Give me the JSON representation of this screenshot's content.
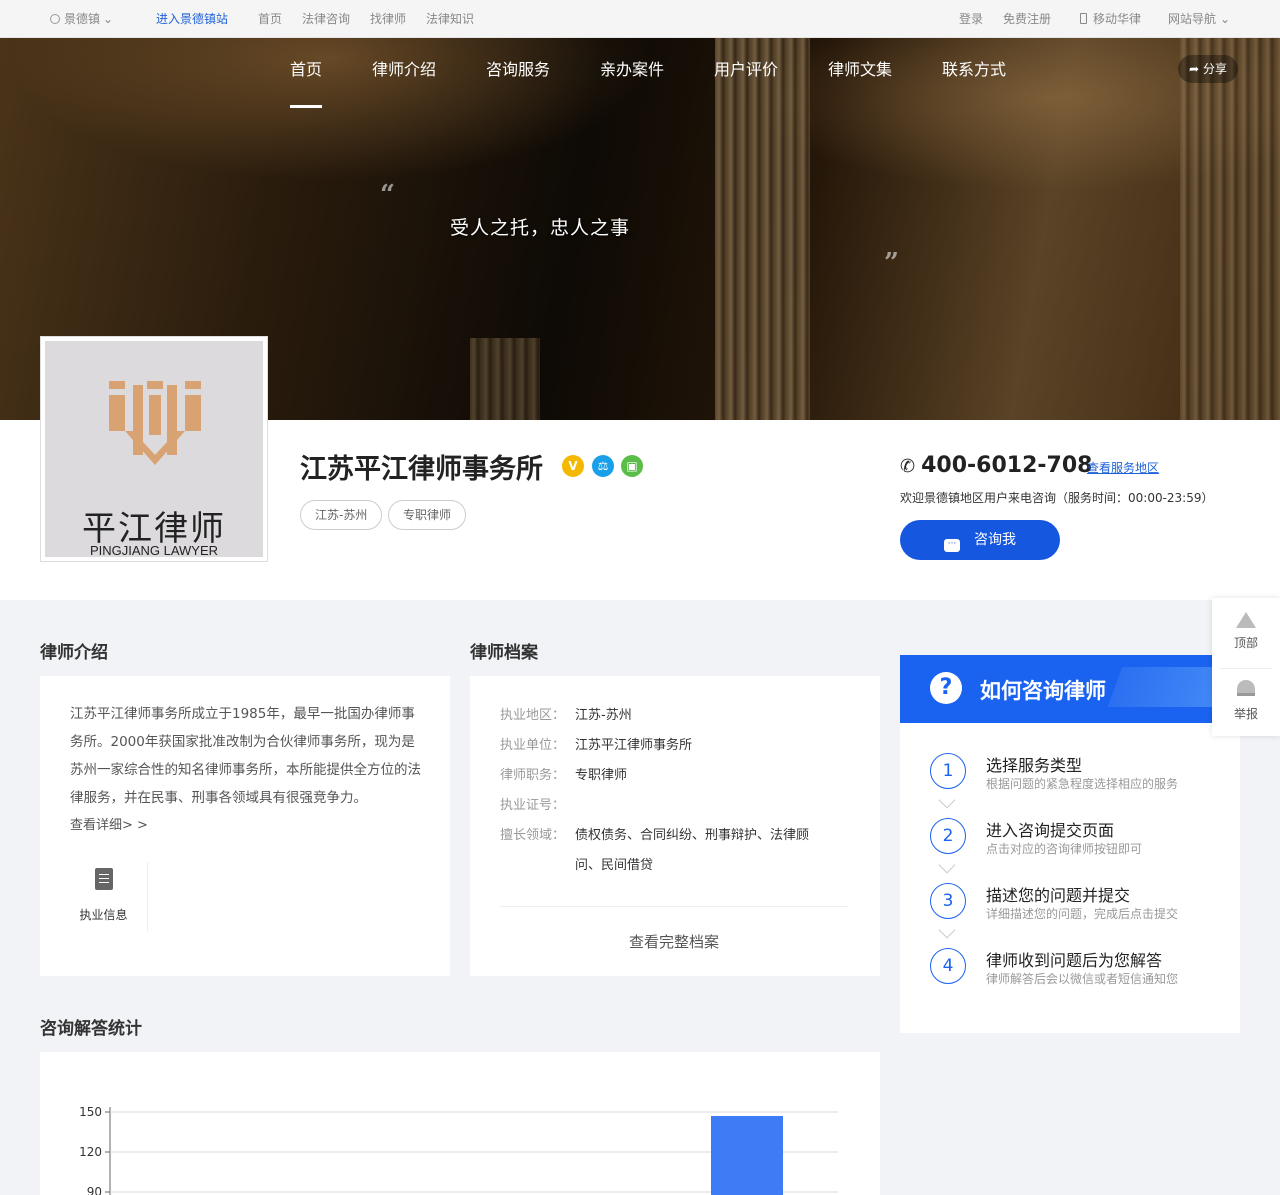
{
  "topbar": {
    "location": "景德镇",
    "station": "进入景德镇站",
    "links": [
      "首页",
      "法律咨询",
      "找律师",
      "法律知识"
    ],
    "login": "登录",
    "register": "免费注册",
    "mobile": "移动华律",
    "sitenav": "网站导航"
  },
  "nav": {
    "items": [
      "首页",
      "律师介绍",
      "咨询服务",
      "亲办案件",
      "用户评价",
      "律师文集",
      "联系方式"
    ],
    "share": "分享"
  },
  "banner": {
    "slogan": "受人之托，忠人之事"
  },
  "logo": {
    "cn": "平江律师",
    "en": "PINGJIANG LAWYER"
  },
  "firm": {
    "name": "江苏平江律师事务所",
    "tags": [
      "江苏-苏州",
      "专职律师"
    ],
    "badge_v": "V"
  },
  "contact": {
    "phone": "400-6012-708",
    "area_link": "查看服务地区",
    "welcome": "欢迎景德镇地区用户来电咨询（服务时间：00:00-23:59）",
    "consult_btn": "咨询我"
  },
  "intro": {
    "title": "律师介绍",
    "text": "江苏平江律师事务所成立于1985年，最早一批国办律师事务所。2000年获国家批准改制为合伙律师事务所，现为是苏州一家综合性的知名律师事务所，本所能提供全方位的法律服务，并在民事、刑事各领域具有很强竞争力。",
    "more": "查看详细> >",
    "info_label": "执业信息"
  },
  "record": {
    "title": "律师档案",
    "rows": [
      {
        "label": "执业地区：",
        "value": "江苏-苏州"
      },
      {
        "label": "执业单位：",
        "value": "江苏平江律师事务所"
      },
      {
        "label": "律师职务：",
        "value": "专职律师"
      },
      {
        "label": "执业证号：",
        "value": ""
      },
      {
        "label": "擅长领域：",
        "value": "债权债务、合同纠纷、刑事辩护、法律顾",
        "value2": "问、民间借贷"
      }
    ],
    "full": "查看完整档案"
  },
  "howto": {
    "title": "如何咨询律师",
    "steps": [
      {
        "num": "1",
        "title": "选择服务类型",
        "desc": "根据问题的紧急程度选择相应的服务"
      },
      {
        "num": "2",
        "title": "进入咨询提交页面",
        "desc": "点击对应的咨询律师按钮即可"
      },
      {
        "num": "3",
        "title": "描述您的问题并提交",
        "desc": "详细描述您的问题，完成后点击提交"
      },
      {
        "num": "4",
        "title": "律师收到问题后为您解答",
        "desc": "律师解答后会以微信或者短信通知您"
      }
    ]
  },
  "side": {
    "top": "顶部",
    "report": "举报"
  },
  "stats": {
    "title": "咨询解答统计"
  },
  "chart_data": {
    "type": "bar",
    "title": "",
    "xlabel": "",
    "ylabel": "",
    "yticks": [
      90,
      120,
      150
    ],
    "ylim": [
      90,
      150
    ],
    "grid": true,
    "series": [
      {
        "values": [
          147
        ]
      }
    ],
    "bar_color": "#3d7cf5"
  },
  "colors": {
    "accent": "#1657e0",
    "brand_blue": "#1a63f0"
  }
}
